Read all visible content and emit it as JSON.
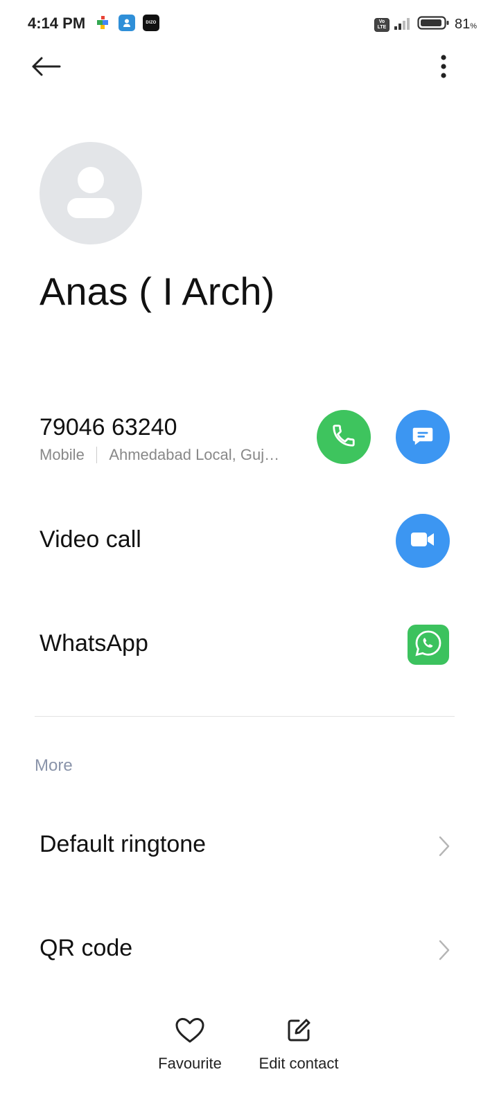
{
  "status_bar": {
    "time": "4:14 PM",
    "notification_icons": [
      "puzzle-app-icon",
      "contacts-app-icon",
      "dizo-app-icon"
    ],
    "dizo_label": "DIZO",
    "volte_label": "Vo LTE",
    "battery_percent": "81",
    "battery_unit": "%"
  },
  "contact": {
    "name": "Anas ( I Arch)",
    "phone": {
      "number": "79046 63240",
      "type": "Mobile",
      "location": "Ahmedabad Local, Guj…"
    }
  },
  "actions": {
    "video_call_label": "Video call",
    "whatsapp_label": "WhatsApp"
  },
  "more_section": {
    "title": "More",
    "items": [
      {
        "label": "Default ringtone"
      },
      {
        "label": "QR code"
      }
    ]
  },
  "bottom_bar": {
    "favourite_label": "Favourite",
    "edit_label": "Edit contact"
  },
  "colors": {
    "call_green": "#3ec45e",
    "action_blue": "#3c96f2",
    "whatsapp_green": "#3cc25e",
    "avatar_bg": "#e3e5e8",
    "section_header": "#8a94aa"
  }
}
